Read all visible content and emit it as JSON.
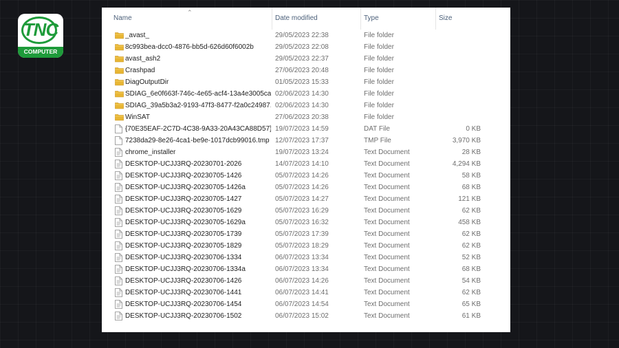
{
  "brand": {
    "logo_text": "TNC",
    "logo_subtext": "COMPUTER"
  },
  "columns": {
    "name": "Name",
    "date": "Date modified",
    "type": "Type",
    "size": "Size"
  },
  "colors": {
    "folder": "#e8b634",
    "brand_green": "#1e9b3a",
    "header_text": "#4c607a"
  },
  "files": [
    {
      "name": "_avast_",
      "date": "29/05/2023 22:38",
      "type": "File folder",
      "size": "",
      "icon": "folder-icon"
    },
    {
      "name": "8c993bea-dcc0-4876-bb5d-626d60f6002b",
      "date": "29/05/2023 22:08",
      "type": "File folder",
      "size": "",
      "icon": "folder-icon"
    },
    {
      "name": "avast_ash2",
      "date": "29/05/2023 22:37",
      "type": "File folder",
      "size": "",
      "icon": "folder-icon"
    },
    {
      "name": "Crashpad",
      "date": "27/06/2023 20:48",
      "type": "File folder",
      "size": "",
      "icon": "folder-icon"
    },
    {
      "name": "DiagOutputDir",
      "date": "01/05/2023 15:33",
      "type": "File folder",
      "size": "",
      "icon": "folder-icon"
    },
    {
      "name": "SDIAG_6e0f663f-746c-4e65-acf4-13a4e3005cac",
      "date": "02/06/2023 14:30",
      "type": "File folder",
      "size": "",
      "icon": "folder-icon"
    },
    {
      "name": "SDIAG_39a5b3a2-9193-47f3-8477-f2a0c24987...",
      "date": "02/06/2023 14:30",
      "type": "File folder",
      "size": "",
      "icon": "folder-icon"
    },
    {
      "name": "WinSAT",
      "date": "27/06/2023 20:38",
      "type": "File folder",
      "size": "",
      "icon": "folder-icon"
    },
    {
      "name": "{70E35EAF-2C7D-4C38-9A33-20A43CA88D57}...",
      "date": "19/07/2023 14:59",
      "type": "DAT File",
      "size": "0 KB",
      "icon": "file-icon"
    },
    {
      "name": "7238da29-8e26-4ca1-be9e-1017dcb99016.tmp",
      "date": "12/07/2023 17:37",
      "type": "TMP File",
      "size": "3,970 KB",
      "icon": "file-icon"
    },
    {
      "name": "chrome_installer",
      "date": "19/07/2023 13:24",
      "type": "Text Document",
      "size": "28 KB",
      "icon": "text-document-icon"
    },
    {
      "name": "DESKTOP-UCJJ3RQ-20230701-2026",
      "date": "14/07/2023 14:10",
      "type": "Text Document",
      "size": "4,294 KB",
      "icon": "text-document-icon"
    },
    {
      "name": "DESKTOP-UCJJ3RQ-20230705-1426",
      "date": "05/07/2023 14:26",
      "type": "Text Document",
      "size": "58 KB",
      "icon": "text-document-icon"
    },
    {
      "name": "DESKTOP-UCJJ3RQ-20230705-1426a",
      "date": "05/07/2023 14:26",
      "type": "Text Document",
      "size": "68 KB",
      "icon": "text-document-icon"
    },
    {
      "name": "DESKTOP-UCJJ3RQ-20230705-1427",
      "date": "05/07/2023 14:27",
      "type": "Text Document",
      "size": "121 KB",
      "icon": "text-document-icon"
    },
    {
      "name": "DESKTOP-UCJJ3RQ-20230705-1629",
      "date": "05/07/2023 16:29",
      "type": "Text Document",
      "size": "62 KB",
      "icon": "text-document-icon"
    },
    {
      "name": "DESKTOP-UCJJ3RQ-20230705-1629a",
      "date": "05/07/2023 16:32",
      "type": "Text Document",
      "size": "458 KB",
      "icon": "text-document-icon"
    },
    {
      "name": "DESKTOP-UCJJ3RQ-20230705-1739",
      "date": "05/07/2023 17:39",
      "type": "Text Document",
      "size": "62 KB",
      "icon": "text-document-icon"
    },
    {
      "name": "DESKTOP-UCJJ3RQ-20230705-1829",
      "date": "05/07/2023 18:29",
      "type": "Text Document",
      "size": "62 KB",
      "icon": "text-document-icon"
    },
    {
      "name": "DESKTOP-UCJJ3RQ-20230706-1334",
      "date": "06/07/2023 13:34",
      "type": "Text Document",
      "size": "52 KB",
      "icon": "text-document-icon"
    },
    {
      "name": "DESKTOP-UCJJ3RQ-20230706-1334a",
      "date": "06/07/2023 13:34",
      "type": "Text Document",
      "size": "68 KB",
      "icon": "text-document-icon"
    },
    {
      "name": "DESKTOP-UCJJ3RQ-20230706-1426",
      "date": "06/07/2023 14:26",
      "type": "Text Document",
      "size": "54 KB",
      "icon": "text-document-icon"
    },
    {
      "name": "DESKTOP-UCJJ3RQ-20230706-1441",
      "date": "06/07/2023 14:41",
      "type": "Text Document",
      "size": "62 KB",
      "icon": "text-document-icon"
    },
    {
      "name": "DESKTOP-UCJJ3RQ-20230706-1454",
      "date": "06/07/2023 14:54",
      "type": "Text Document",
      "size": "65 KB",
      "icon": "text-document-icon"
    },
    {
      "name": "DESKTOP-UCJJ3RQ-20230706-1502",
      "date": "06/07/2023 15:02",
      "type": "Text Document",
      "size": "61 KB",
      "icon": "text-document-icon"
    }
  ]
}
